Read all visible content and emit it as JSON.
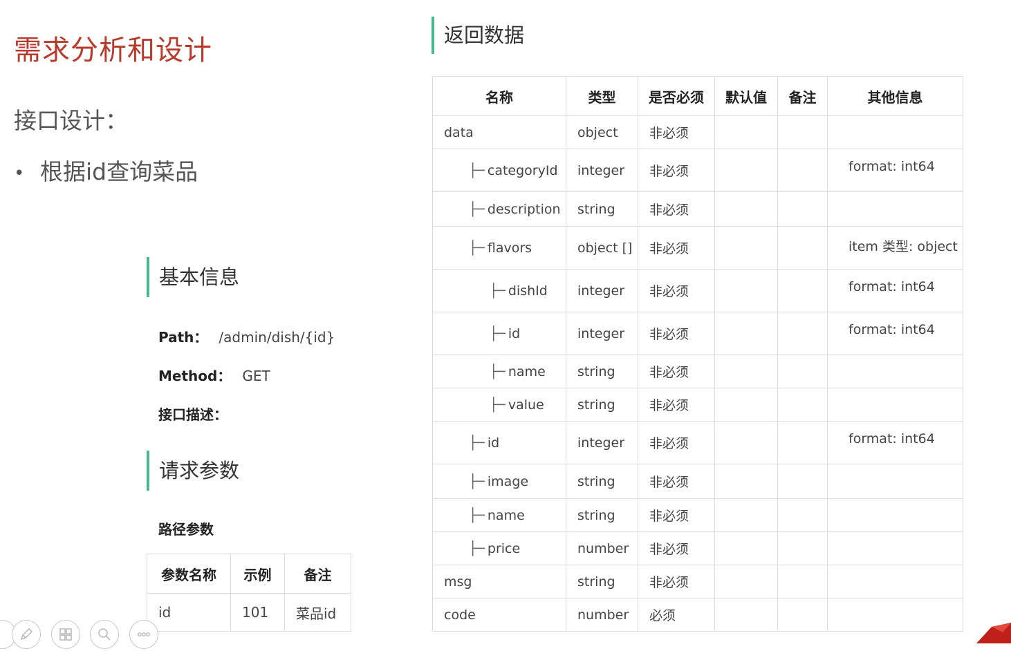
{
  "slide": {
    "title": "需求分析和设计",
    "subtitle": "接口设计：",
    "bullet": "根据id查询菜品"
  },
  "basic_info": {
    "heading": "基本信息",
    "path_label": "Path：",
    "path_value": "/admin/dish/{id}",
    "method_label": "Method：",
    "method_value": "GET",
    "desc_label": "接口描述："
  },
  "request": {
    "heading": "请求参数",
    "path_params_label": "路径参数",
    "columns": [
      "参数名称",
      "示例",
      "备注"
    ],
    "rows": [
      [
        "id",
        "101",
        "菜品id"
      ]
    ]
  },
  "response": {
    "heading": "返回数据",
    "columns": [
      "名称",
      "类型",
      "是否必须",
      "默认值",
      "备注",
      "其他信息"
    ],
    "rows": [
      {
        "name": "data",
        "level": 0,
        "type": "object",
        "required": "非必须",
        "default": "",
        "note": "",
        "other": ""
      },
      {
        "name": "categoryId",
        "level": 1,
        "type": "integer",
        "required": "非必须",
        "default": "",
        "note": "",
        "other": "format: int64"
      },
      {
        "name": "description",
        "level": 1,
        "type": "string",
        "required": "非必须",
        "default": "",
        "note": "",
        "other": ""
      },
      {
        "name": "flavors",
        "level": 1,
        "type": "object []",
        "required": "非必须",
        "default": "",
        "note": "",
        "other": "item 类型: object"
      },
      {
        "name": "dishId",
        "level": 2,
        "type": "integer",
        "required": "非必须",
        "default": "",
        "note": "",
        "other": "format: int64"
      },
      {
        "name": "id",
        "level": 2,
        "type": "integer",
        "required": "非必须",
        "default": "",
        "note": "",
        "other": "format: int64"
      },
      {
        "name": "name",
        "level": 2,
        "type": "string",
        "required": "非必须",
        "default": "",
        "note": "",
        "other": ""
      },
      {
        "name": "value",
        "level": 2,
        "type": "string",
        "required": "非必须",
        "default": "",
        "note": "",
        "other": ""
      },
      {
        "name": "id",
        "level": 1,
        "type": "integer",
        "required": "非必须",
        "default": "",
        "note": "",
        "other": "format: int64"
      },
      {
        "name": "image",
        "level": 1,
        "type": "string",
        "required": "非必须",
        "default": "",
        "note": "",
        "other": ""
      },
      {
        "name": "name",
        "level": 1,
        "type": "string",
        "required": "非必须",
        "default": "",
        "note": "",
        "other": ""
      },
      {
        "name": "price",
        "level": 1,
        "type": "number",
        "required": "非必须",
        "default": "",
        "note": "",
        "other": ""
      },
      {
        "name": "msg",
        "level": 0,
        "type": "string",
        "required": "非必须",
        "default": "",
        "note": "",
        "other": ""
      },
      {
        "name": "code",
        "level": 0,
        "type": "number",
        "required": "必须",
        "default": "",
        "note": "",
        "other": ""
      }
    ]
  },
  "toolbar": {
    "icons": [
      "pen-icon",
      "grid-icon",
      "zoom-icon",
      "more-icon"
    ]
  },
  "colors": {
    "title": "#b83a2c",
    "section_bar": "#4ab88f",
    "corner": "#c0201a"
  }
}
